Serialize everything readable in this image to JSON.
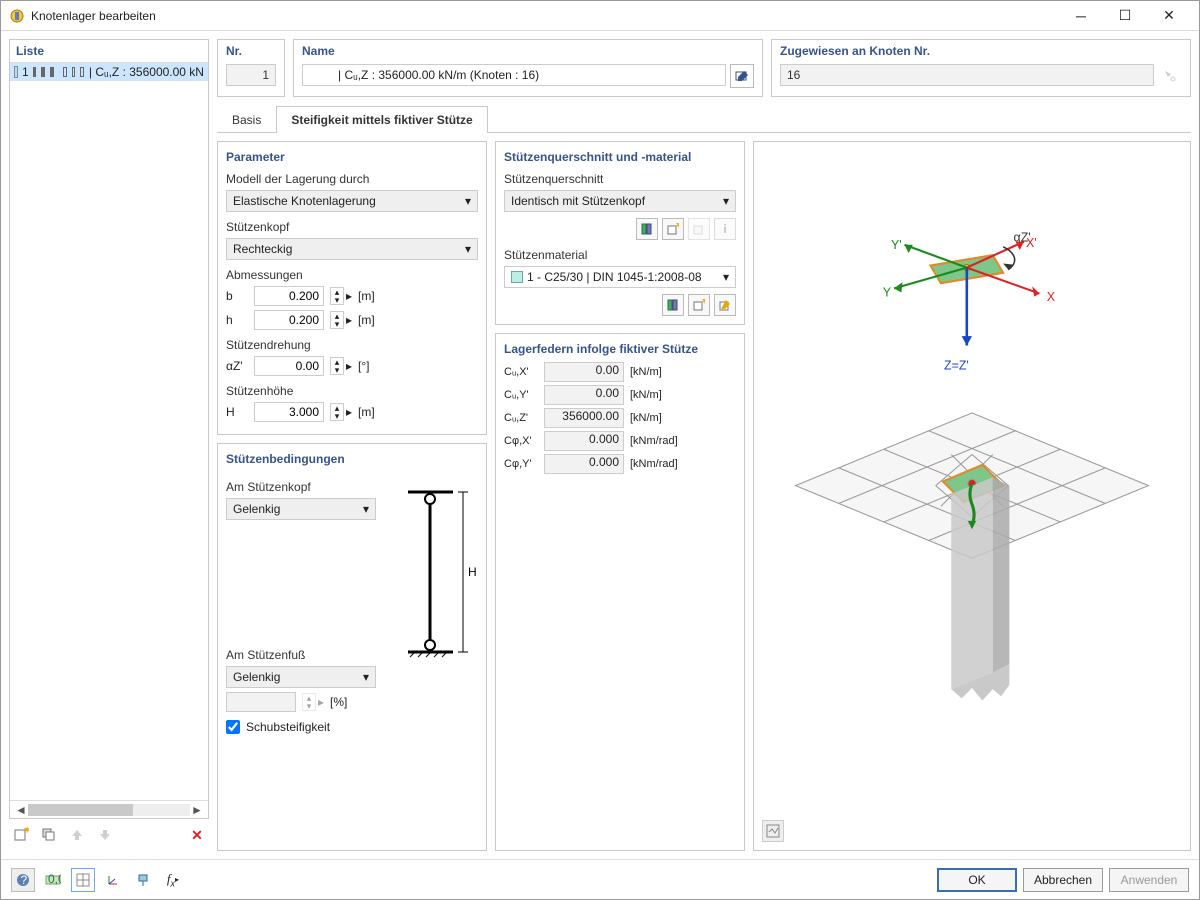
{
  "window": {
    "title": "Knotenlager bearbeiten"
  },
  "sidebar": {
    "header": "Liste",
    "item_num": "1",
    "item_text": "| Cᵤ,Z : 356000.00 kN"
  },
  "header": {
    "nr_label": "Nr.",
    "nr_value": "1",
    "name_label": "Name",
    "name_value": "| Cᵤ,Z : 356000.00 kN/m (Knoten : 16)",
    "assigned_label": "Zugewiesen an Knoten Nr.",
    "assigned_value": "16"
  },
  "tabs": {
    "t1": "Basis",
    "t2": "Steifigkeit mittels fiktiver Stütze"
  },
  "parameter": {
    "title": "Parameter",
    "model_label": "Modell der Lagerung durch",
    "model_value": "Elastische Knotenlagerung",
    "head_label": "Stützenkopf",
    "head_value": "Rechteckig",
    "dim_label": "Abmessungen",
    "b_label": "b",
    "b_value": "0.200",
    "b_unit": "[m]",
    "h_label": "h",
    "h_value": "0.200",
    "h_unit": "[m]",
    "rot_label": "Stützendrehung",
    "rot_sym": "αZ'",
    "rot_value": "0.00",
    "rot_unit": "[°]",
    "height_label": "Stützenhöhe",
    "H_label": "H",
    "H_value": "3.000",
    "H_unit": "[m]"
  },
  "conditions": {
    "title": "Stützenbedingungen",
    "top_label": "Am Stützenkopf",
    "top_value": "Gelenkig",
    "bot_label": "Am Stützenfuß",
    "bot_value": "Gelenkig",
    "pct_unit": "[%]",
    "shear_label": "Schubsteifigkeit"
  },
  "cross": {
    "title": "Stützenquerschnitt und -material",
    "cs_label": "Stützenquerschnitt",
    "cs_value": "Identisch mit Stützenkopf",
    "mat_label": "Stützenmaterial",
    "mat_value": "1 - C25/30 | DIN 1045-1:2008-08"
  },
  "springs": {
    "title": "Lagerfedern infolge fiktiver Stütze",
    "rows": [
      {
        "label": "Cᵤ,X'",
        "value": "0.00",
        "unit": "[kN/m]"
      },
      {
        "label": "Cᵤ,Y'",
        "value": "0.00",
        "unit": "[kN/m]"
      },
      {
        "label": "Cᵤ,Z'",
        "value": "356000.00",
        "unit": "[kN/m]"
      },
      {
        "label": "Cφ,X'",
        "value": "0.000",
        "unit": "[kNm/rad]"
      },
      {
        "label": "Cφ,Y'",
        "value": "0.000",
        "unit": "[kNm/rad]"
      }
    ]
  },
  "preview_labels": {
    "x": "X",
    "xp": "X'",
    "y": "Y",
    "yp": "Y'",
    "z": "Z=Z'",
    "az": "αZ'"
  },
  "buttons": {
    "ok": "OK",
    "cancel": "Abbrechen",
    "apply": "Anwenden"
  }
}
